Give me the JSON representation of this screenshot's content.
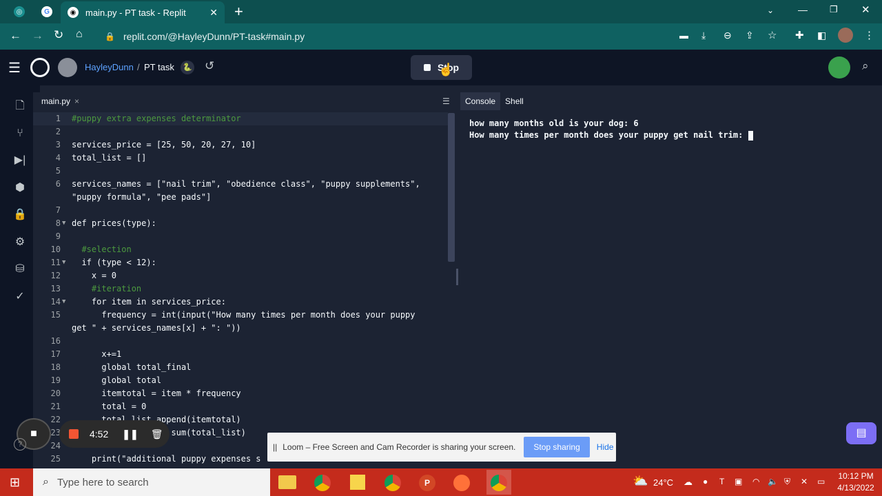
{
  "browser": {
    "tab_title": "main.py - PT task - Replit",
    "url": "replit.com/@HayleyDunn/PT-task#main.py",
    "new_tab": "+",
    "window_controls": [
      "minimize",
      "restore",
      "close"
    ]
  },
  "replit": {
    "user": "HayleyDunn",
    "separator": "/",
    "project": "PT task",
    "stop_label": "Stop"
  },
  "editor": {
    "file_tab": "main.py",
    "close_glyph": "×",
    "lines": [
      {
        "n": "1",
        "text": "#puppy extra expenses determinator",
        "kind": "comment"
      },
      {
        "n": "2",
        "text": ""
      },
      {
        "n": "3",
        "text": "services_price = [25, 50, 20, 27, 10]"
      },
      {
        "n": "4",
        "text": "total_list = []"
      },
      {
        "n": "5",
        "text": ""
      },
      {
        "n": "6",
        "text": "services_names = [\"nail trim\", \"obedience class\", \"puppy supplements\","
      },
      {
        "n": "",
        "text": "\"puppy formula\", \"pee pads\"]"
      },
      {
        "n": "7",
        "text": ""
      },
      {
        "n": "8",
        "text": "def prices(type):",
        "fold": true
      },
      {
        "n": "9",
        "text": ""
      },
      {
        "n": "10",
        "text": "  #selection",
        "kind": "comment"
      },
      {
        "n": "11",
        "text": "  if (type < 12):",
        "fold": true
      },
      {
        "n": "12",
        "text": "    x = 0"
      },
      {
        "n": "13",
        "text": "    #iteration",
        "kind": "comment"
      },
      {
        "n": "14",
        "text": "    for item in services_price:",
        "fold": true
      },
      {
        "n": "15",
        "text": "      frequency = int(input(\"How many times per month does your puppy"
      },
      {
        "n": "",
        "text": "get \" + services_names[x] + \": \"))"
      },
      {
        "n": "16",
        "text": ""
      },
      {
        "n": "17",
        "text": "      x+=1"
      },
      {
        "n": "18",
        "text": "      global total_final"
      },
      {
        "n": "19",
        "text": "      global total"
      },
      {
        "n": "20",
        "text": "      itemtotal = item * frequency"
      },
      {
        "n": "21",
        "text": "      total = 0"
      },
      {
        "n": "22",
        "text": "      total_list.append(itemtotal)"
      },
      {
        "n": "23",
        "text": "      total_final = sum(total_list)"
      },
      {
        "n": "24",
        "text": ""
      },
      {
        "n": "25",
        "text": "    print(\"additional puppy expenses s"
      }
    ]
  },
  "console": {
    "tabs": [
      "Console",
      "Shell"
    ],
    "lines": [
      "how many months old is your dog: 6",
      "How many times per month does your puppy get nail trim: "
    ]
  },
  "loom": {
    "timer": "4:52",
    "message": "Loom – Free Screen and Cam Recorder is sharing your screen.",
    "stop_sharing": "Stop sharing",
    "hide": "Hide"
  },
  "taskbar": {
    "search_placeholder": "Type here to search",
    "weather": "24°C",
    "time": "10:12 PM",
    "date": "4/13/2022"
  },
  "colors": {
    "browser_tabbar": "#0d4f4f",
    "browser_toolbar": "#0f6161",
    "replit_bg": "#0e1525",
    "editor_bg": "#1c2333",
    "taskbar": "#c42b1c",
    "accent_blue": "#0079f2",
    "loom_button": "#6b9cf7"
  }
}
